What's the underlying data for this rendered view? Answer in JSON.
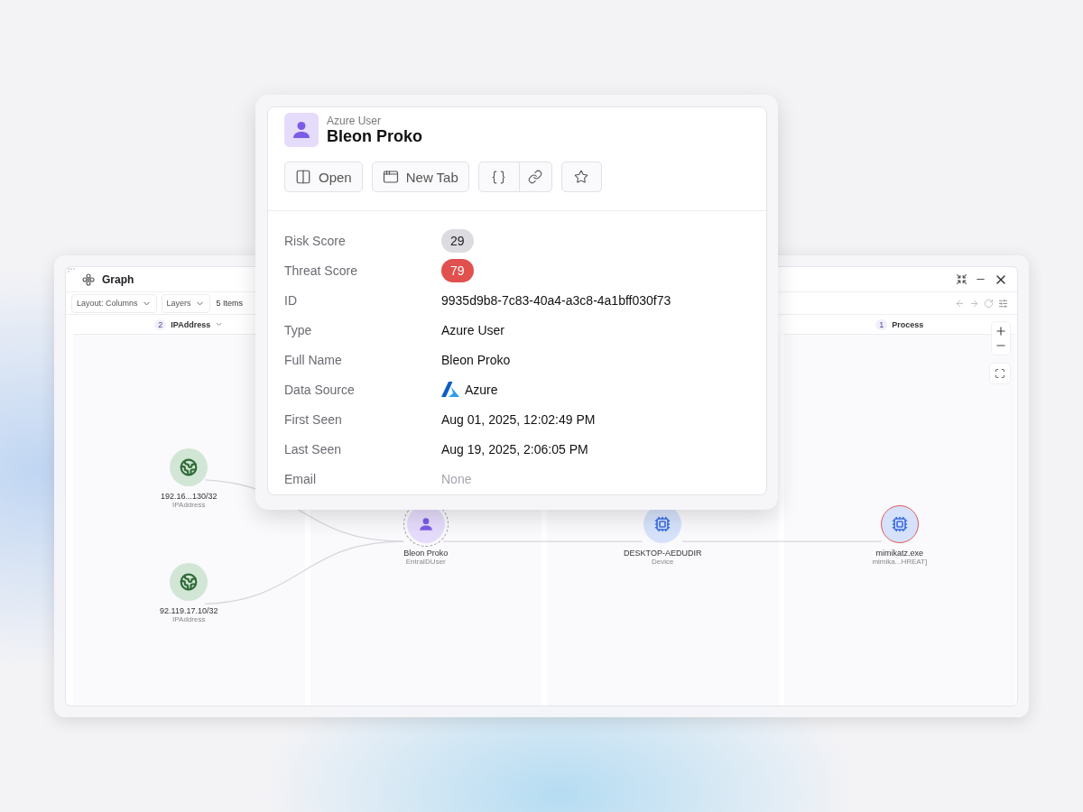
{
  "graph_window": {
    "title": "Graph",
    "toolbar": {
      "layout": "Layout: Columns",
      "layers": "Layers",
      "items": "5 Items"
    },
    "columns": [
      {
        "count": "2",
        "label": "IPAddress",
        "nodes": [
          {
            "kind": "ip",
            "label": "192.16...130/32",
            "type": "IPAddress",
            "selected": false,
            "flagged": false
          },
          {
            "kind": "ip",
            "label": "92.119.17.10/32",
            "type": "IPAddress",
            "selected": false,
            "flagged": false
          }
        ]
      },
      {
        "nodes": [
          {
            "kind": "user",
            "label": "Bleon Proko",
            "type": "EntraIDUser",
            "selected": true,
            "flagged": false
          }
        ]
      },
      {
        "nodes": [
          {
            "kind": "device",
            "label": "DESKTOP-AEDUDIR",
            "type": "Device",
            "selected": false,
            "flagged": false
          }
        ]
      },
      {
        "count": "1",
        "label": "Process",
        "nodes": [
          {
            "kind": "device",
            "label": "mimikatz.exe",
            "type": "mimika...HREAT]",
            "selected": false,
            "flagged": true
          }
        ]
      }
    ]
  },
  "popup": {
    "subtitle": "Azure User",
    "title": "Bleon Proko",
    "buttons": [
      {
        "kind": "open",
        "label": "Open"
      },
      {
        "kind": "tab",
        "label": "New Tab"
      }
    ],
    "fields": [
      {
        "kind": "badge",
        "label": "Risk Score",
        "value": "29",
        "color": "#dcdbe0"
      },
      {
        "kind": "badge",
        "label": "Threat Score",
        "value": "79",
        "color": "#e0504e"
      },
      {
        "kind": "text",
        "label": "ID",
        "value": "9935d9b8-7c83-40a4-a3c8-4a1bff030f73"
      },
      {
        "kind": "text",
        "label": "Type",
        "value": "Azure User"
      },
      {
        "kind": "text",
        "label": "Full Name",
        "value": "Bleon Proko"
      },
      {
        "kind": "source",
        "label": "Data Source",
        "value": "Azure"
      },
      {
        "kind": "text",
        "label": "First Seen",
        "value": "Aug 01, 2025, 12:02:49 PM"
      },
      {
        "kind": "text",
        "label": "Last Seen",
        "value": "Aug 19, 2025, 2:06:05 PM"
      },
      {
        "kind": "empty",
        "label": "Email",
        "value": "None"
      }
    ]
  }
}
